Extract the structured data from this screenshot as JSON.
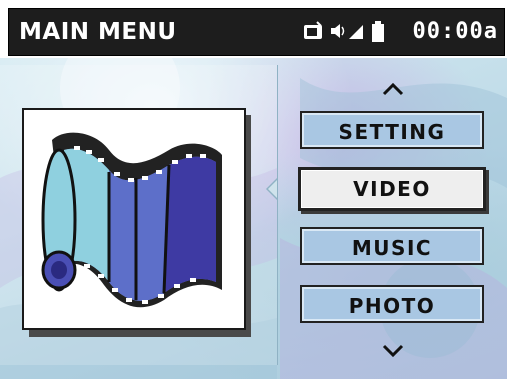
{
  "header": {
    "title": "MAIN MENU",
    "clock": "00:00a",
    "status_icons": [
      "tv-icon",
      "speaker-icon",
      "signal-icon",
      "battery-icon"
    ]
  },
  "menu": {
    "items": [
      {
        "label": "SETTING",
        "selected": false
      },
      {
        "label": "VIDEO",
        "selected": true
      },
      {
        "label": "MUSIC",
        "selected": false
      },
      {
        "label": "PHOTO",
        "selected": false
      }
    ],
    "scroll_up_icon": "chevron-up-icon",
    "scroll_down_icon": "chevron-down-icon"
  },
  "preview": {
    "icon": "film-strip-icon"
  },
  "colors": {
    "header_bg": "#1d1d1d",
    "button_bg": "#a9c7e3",
    "selected_bg": "#eeeeee"
  }
}
